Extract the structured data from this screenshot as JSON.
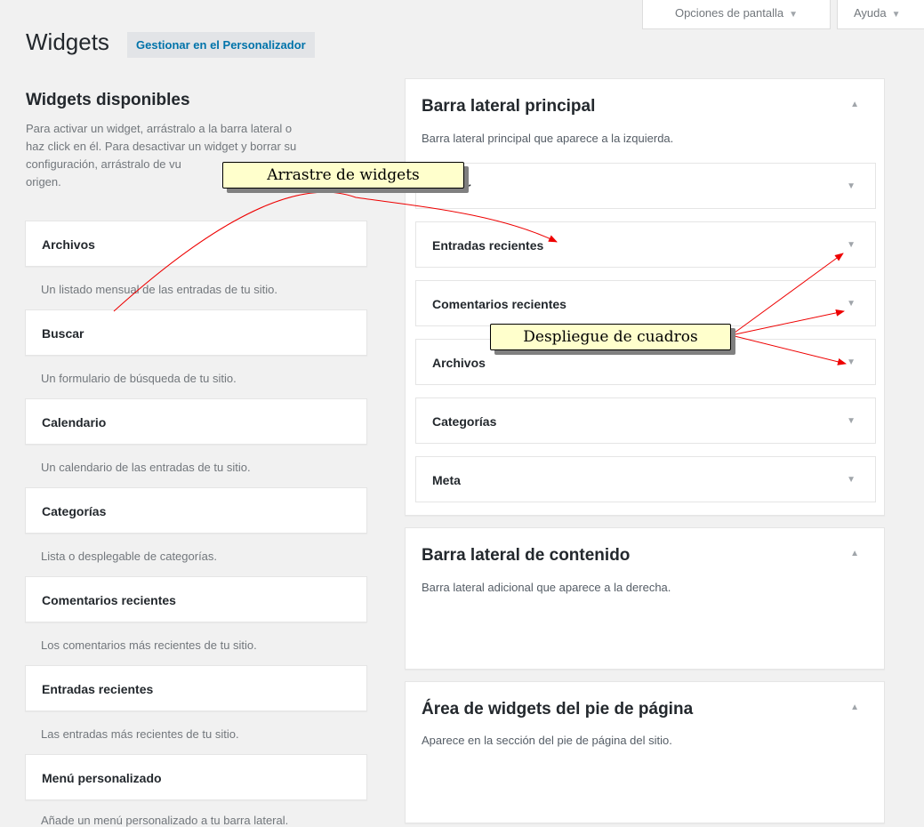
{
  "topbar": {
    "screen_options": "Opciones de pantalla",
    "help": "Ayuda",
    "arrow": "▼"
  },
  "header": {
    "title": "Widgets",
    "customize_button": "Gestionar en el Personalizador"
  },
  "available": {
    "title": "Widgets disponibles",
    "desc_lines": [
      "Para activar un widget, arrástralo a la barra lateral o",
      "haz click en él. Para desactivar un widget y borrar su",
      "configuración, arrástralo de vu",
      "origen."
    ],
    "widgets": [
      {
        "name": "Archivos",
        "desc": "Un listado mensual de las entradas de tu sitio."
      },
      {
        "name": "Buscar",
        "desc": "Un formulario de búsqueda de tu sitio."
      },
      {
        "name": "Calendario",
        "desc": "Un calendario de las entradas de tu sitio."
      },
      {
        "name": "Categorías",
        "desc": "Lista o desplegable de categorías."
      },
      {
        "name": "Comentarios recientes",
        "desc": "Los comentarios más recientes de tu sitio."
      },
      {
        "name": "Entradas recientes",
        "desc": "Las entradas más recientes de tu sitio."
      },
      {
        "name": "Menú personalizado",
        "desc": "Añade un menú personalizado a tu barra lateral."
      }
    ]
  },
  "sidebars": [
    {
      "title": "Barra lateral principal",
      "desc": "Barra lateral principal que aparece a la izquierda.",
      "toggle": "▲",
      "widgets": [
        "r",
        "Entradas recientes",
        "Comentarios recientes",
        "Archivos",
        "Categorías",
        "Meta"
      ]
    },
    {
      "title": "Barra lateral de contenido",
      "desc": "Barra lateral adicional que aparece a la derecha.",
      "toggle": "▲",
      "widgets": []
    },
    {
      "title": "Área de widgets del pie de página",
      "desc": "Aparece en la sección del pie de página del sitio.",
      "toggle": "▲",
      "widgets": []
    }
  ],
  "widget_caret": "▼",
  "annotations": {
    "drag_label": "Arrastre de widgets",
    "expand_label": "Despliegue de cuadros",
    "color": "#ee0000"
  }
}
